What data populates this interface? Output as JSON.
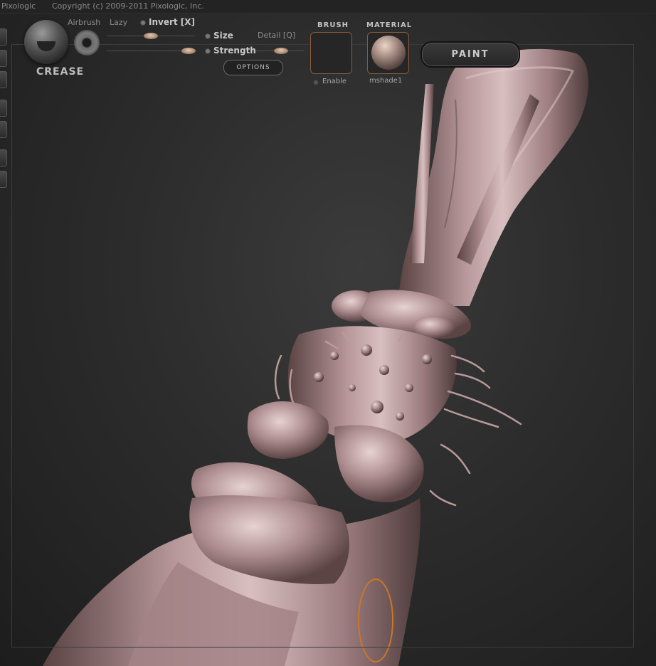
{
  "topbar": {
    "brand": "Pixologic",
    "copyright": "Copyright (c) 2009-2011 Pixologic, Inc."
  },
  "brush": {
    "name": "CREASE",
    "airbrush_label": "Airbrush",
    "lazy_label": "Lazy",
    "invert_label": "Invert [X]",
    "size_label": "Size",
    "strength_label": "Strength",
    "detail_label": "Detail [Q]",
    "options_label": "OPTIONS"
  },
  "brush_panel": {
    "title": "BRUSH",
    "enable_label": "Enable"
  },
  "material_panel": {
    "title": "MATERIAL",
    "material_name": "mshade1"
  },
  "paint_button": "PAINT",
  "colors": {
    "accent_border": "#8a5a3a",
    "model_skin": "#b99a98",
    "brush_cursor": "#c8772a"
  },
  "icons": {
    "brush_preview": "crease-brush-icon",
    "stroke": "dots-stroke-icon",
    "material": "material-sphere-icon"
  }
}
